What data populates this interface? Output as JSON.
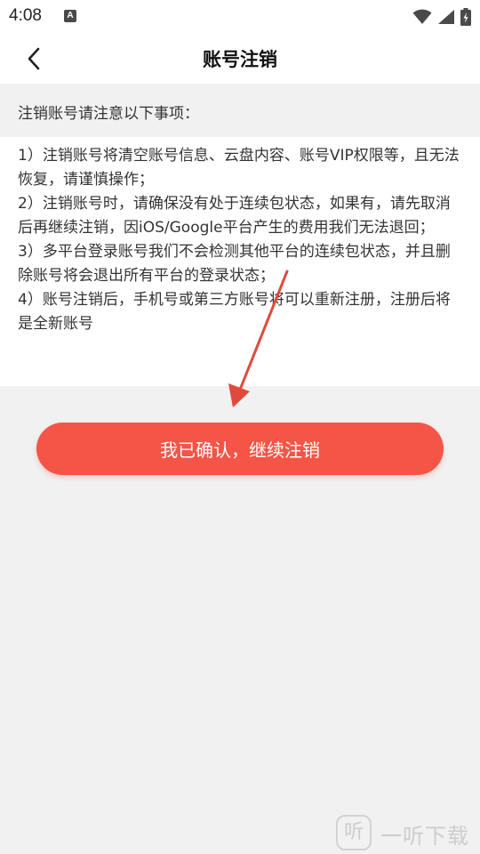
{
  "status_bar": {
    "time": "4:08",
    "notification_icon_label": "A",
    "icons": [
      "wifi-icon",
      "signal-icon",
      "battery-charging-icon"
    ]
  },
  "nav": {
    "back_icon": "chevron-left-icon",
    "title": "账号注销"
  },
  "notice": {
    "heading": "注销账号请注意以下事项：",
    "items": [
      "1）注销账号将清空账号信息、云盘内容、账号VIP权限等，且无法恢复，请谨慎操作；",
      "2）注销账号时，请确保没有处于连续包状态，如果有，请先取消后再继续注销，因iOS/Google平台产生的费用我们无法退回；",
      "3）多平台登录账号我们不会检测其他平台的连续包状态，并且删除账号将会退出所有平台的登录状态；",
      "4）账号注销后，手机号或第三方账号将可以重新注册，注册后将是全新账号"
    ]
  },
  "confirm_button": {
    "label": "我已确认，继续注销"
  },
  "watermark": {
    "logo_char": "听",
    "text": "一听下载"
  },
  "colors": {
    "accent": "#f45546",
    "arrow": "#e04a3c",
    "background": "#f1f1f1",
    "surface": "#ffffff",
    "text": "#333333"
  }
}
